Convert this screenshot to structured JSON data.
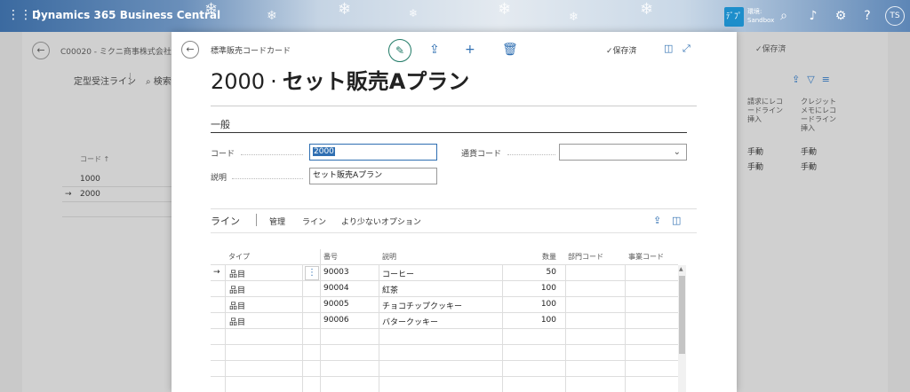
{
  "topbar": {
    "app_title": "Dynamics 365 Business Central",
    "env_badge": "ﾃﾞﾌﾟ",
    "env_name": "環境:",
    "env_value": "Sandbox",
    "avatar": "TS"
  },
  "background": {
    "title": "C00020 - ミクニ商事株式会社",
    "tab": "定型受注ライン",
    "search": "検索",
    "saved": "✓保存済",
    "grid": {
      "header": "コード ↑",
      "rows": [
        "1000",
        "2000"
      ]
    },
    "right_cols": [
      {
        "header": "請求にレコードライン挿入",
        "values": [
          "手動",
          "手動"
        ]
      },
      {
        "header": "クレジットメモにレコードライン挿入",
        "values": [
          "手動",
          "手動"
        ]
      }
    ]
  },
  "modal": {
    "breadcrumb": "標準販売コードカード",
    "saved": "✓保存済",
    "title_number": "2000",
    "title_sep": "·",
    "title_name": "セット販売Aプラン",
    "general_section": "一般",
    "fields": {
      "code_label": "コード",
      "code_value": "2000",
      "description_label": "説明",
      "description_value": "セット販売Aプラン",
      "currency_label": "通貨コード",
      "currency_value": ""
    },
    "lines_bar": {
      "title": "ライン",
      "manage": "管理",
      "line": "ライン",
      "fewer_options": "より少ないオプション"
    },
    "columns": {
      "type": "タイプ",
      "no": "番号",
      "description": "説明",
      "quantity": "数量",
      "dept_code": "部門コード",
      "project_code": "事業コード"
    },
    "rows": [
      {
        "type": "品目",
        "no": "90003",
        "description": "コーヒー",
        "quantity": "50"
      },
      {
        "type": "品目",
        "no": "90004",
        "description": "紅茶",
        "quantity": "100"
      },
      {
        "type": "品目",
        "no": "90005",
        "description": "チョコチップクッキー",
        "quantity": "100"
      },
      {
        "type": "品目",
        "no": "90006",
        "description": "バタークッキー",
        "quantity": "100"
      }
    ]
  },
  "colors": {
    "accent": "#2f6fb2",
    "edit": "#1f7a66"
  }
}
